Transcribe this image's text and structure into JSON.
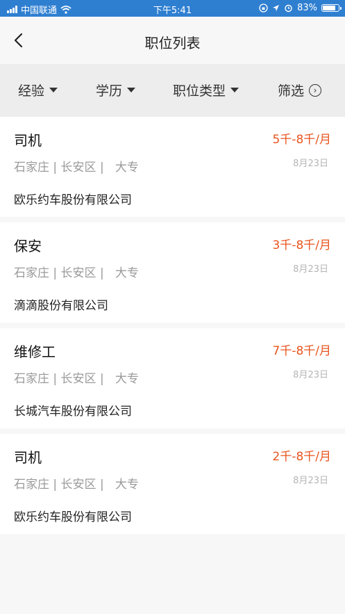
{
  "status_bar": {
    "carrier": "中国联通",
    "time": "下午5:41",
    "battery": "83%",
    "battery_level": 0.83
  },
  "nav": {
    "title": "职位列表",
    "back_icon": "chevron-left-icon"
  },
  "filters": [
    {
      "label": "经验",
      "icon": "caret-down-icon"
    },
    {
      "label": "学历",
      "icon": "caret-down-icon"
    },
    {
      "label": "职位类型",
      "icon": "caret-down-icon"
    },
    {
      "label": "筛选",
      "icon": "circle-chevron-right-icon"
    }
  ],
  "jobs": [
    {
      "title": "司机",
      "salary": "5千-8千/月",
      "location": "石家庄 | 长安区 |   大专",
      "date": "8月23日",
      "company": "欧乐约车股份有限公司"
    },
    {
      "title": "保安",
      "salary": "3千-8千/月",
      "location": "石家庄 | 长安区 |   大专",
      "date": "8月23日",
      "company": "滴滴股份有限公司"
    },
    {
      "title": "维修工",
      "salary": "7千-8千/月",
      "location": "石家庄 | 长安区 |   大专",
      "date": "8月23日",
      "company": "长城汽车股份有限公司"
    },
    {
      "title": "司机",
      "salary": "2千-8千/月",
      "location": "石家庄 | 长安区 |   大专",
      "date": "8月23日",
      "company": "欧乐约车股份有限公司"
    }
  ],
  "colors": {
    "status_bar": "#2f7fd1",
    "salary": "#e8541e",
    "filter_bg": "#ededed"
  }
}
